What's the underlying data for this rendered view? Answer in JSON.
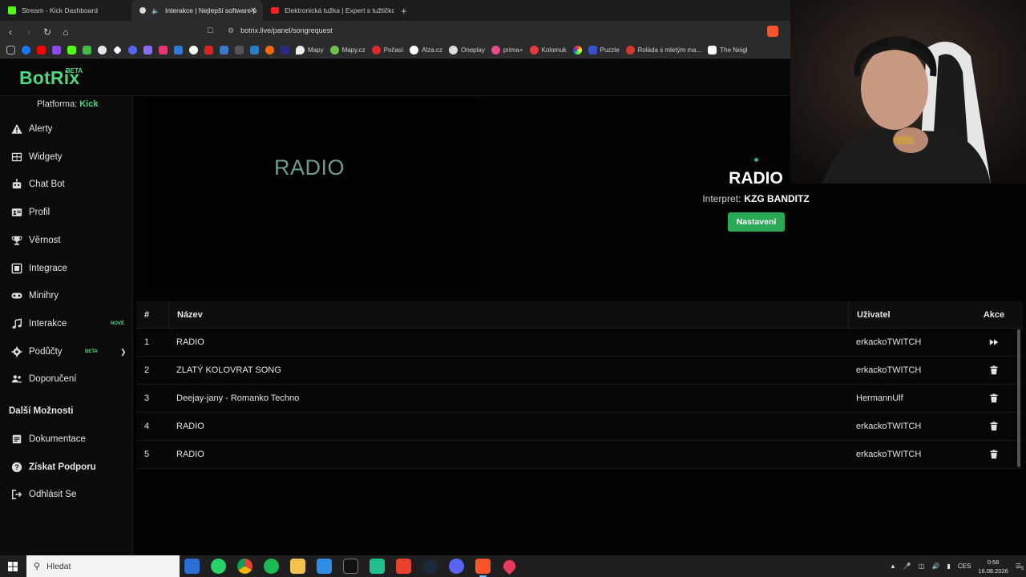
{
  "browser": {
    "tabs": [
      {
        "title": "Stream - Kick Dashboard",
        "icon": "kick-icon",
        "active": false
      },
      {
        "title": "Interakce | Nejlepší software p",
        "icon": "botrix-icon",
        "active": true,
        "audio_icon": "speaker-icon"
      },
      {
        "title": "Elektronická tužka | Expert s tužtičkou",
        "icon": "youtube-icon",
        "active": false
      }
    ],
    "new_tab": "+",
    "url": "botrix.live/panel/songrequest",
    "bookmarks": [
      {
        "label": "Mapy",
        "icon": "map-pin-icon"
      },
      {
        "label": "Mapy.cz",
        "icon": "mapy-icon"
      },
      {
        "label": "Počasí",
        "icon": "weather-icon"
      },
      {
        "label": "Alza.cz",
        "icon": "alza-icon"
      },
      {
        "label": "Oneplay",
        "icon": "oneplay-icon"
      },
      {
        "label": "prima+",
        "icon": "prima-icon"
      },
      {
        "label": "Kolomuk",
        "icon": "kolomuk-icon"
      },
      {
        "label": "Puzzle",
        "icon": "puzzle-icon"
      },
      {
        "label": "Roláda s mletým ma...",
        "icon": "recipe-icon"
      },
      {
        "label": "The Neigl",
        "icon": "tm-icon"
      }
    ]
  },
  "app": {
    "logo": "BotRix",
    "logo_badge": "BETA",
    "platform_label": "Platforma:",
    "platform_value": "Kick",
    "nav": [
      {
        "label": "Alerty",
        "icon": "warning-icon"
      },
      {
        "label": "Widgety",
        "icon": "widgets-icon"
      },
      {
        "label": "Chat Bot",
        "icon": "robot-icon"
      },
      {
        "label": "Profil",
        "icon": "profile-card-icon"
      },
      {
        "label": "Věrnost",
        "icon": "trophy-icon"
      },
      {
        "label": "Integrace",
        "icon": "integration-icon"
      },
      {
        "label": "Minihry",
        "icon": "gamepad-icon"
      },
      {
        "label": "Interakce",
        "icon": "music-icon",
        "badge": "NOVÉ"
      },
      {
        "label": "Podůčty",
        "icon": "users-icon",
        "badge": "BETA"
      },
      {
        "label": "Doporučení",
        "icon": "referral-icon"
      }
    ],
    "more_title": "Další Možnosti",
    "more": [
      {
        "label": "Dokumentace",
        "icon": "docs-icon"
      },
      {
        "label": "Získat Podporu",
        "icon": "help-icon"
      },
      {
        "label": "Odhlásit Se",
        "icon": "logout-icon"
      }
    ]
  },
  "now_playing": {
    "cover_text": "RADIO",
    "title": "RADIO",
    "artist_label": "Interpret:",
    "artist": "KZG BANDITZ",
    "settings_button": "Nastavení"
  },
  "queue": {
    "columns": {
      "num": "#",
      "name": "Název",
      "user": "Uživatel",
      "action": "Akce"
    },
    "rows": [
      {
        "num": "1",
        "name": "RADIO",
        "user": "erkackoTWITCH",
        "action": "skip-icon"
      },
      {
        "num": "2",
        "name": "ZLATÝ KOLOVRAT SONG",
        "user": "erkackoTWITCH",
        "action": "trash-icon"
      },
      {
        "num": "3",
        "name": "Deejay-jany - Romanko Techno",
        "user": "HermannUlf",
        "action": "trash-icon"
      },
      {
        "num": "4",
        "name": "RADIO",
        "user": "erkackoTWITCH",
        "action": "trash-icon"
      },
      {
        "num": "5",
        "name": "RADIO",
        "user": "erkackoTWITCH",
        "action": "trash-icon"
      }
    ]
  },
  "taskbar": {
    "search_placeholder": "Hledat",
    "lang": "CES",
    "time": "0:58",
    "date": "16.08.2026",
    "notifications": "5"
  },
  "colors": {
    "accent": "#4fd67a",
    "button": "#2aa856"
  }
}
